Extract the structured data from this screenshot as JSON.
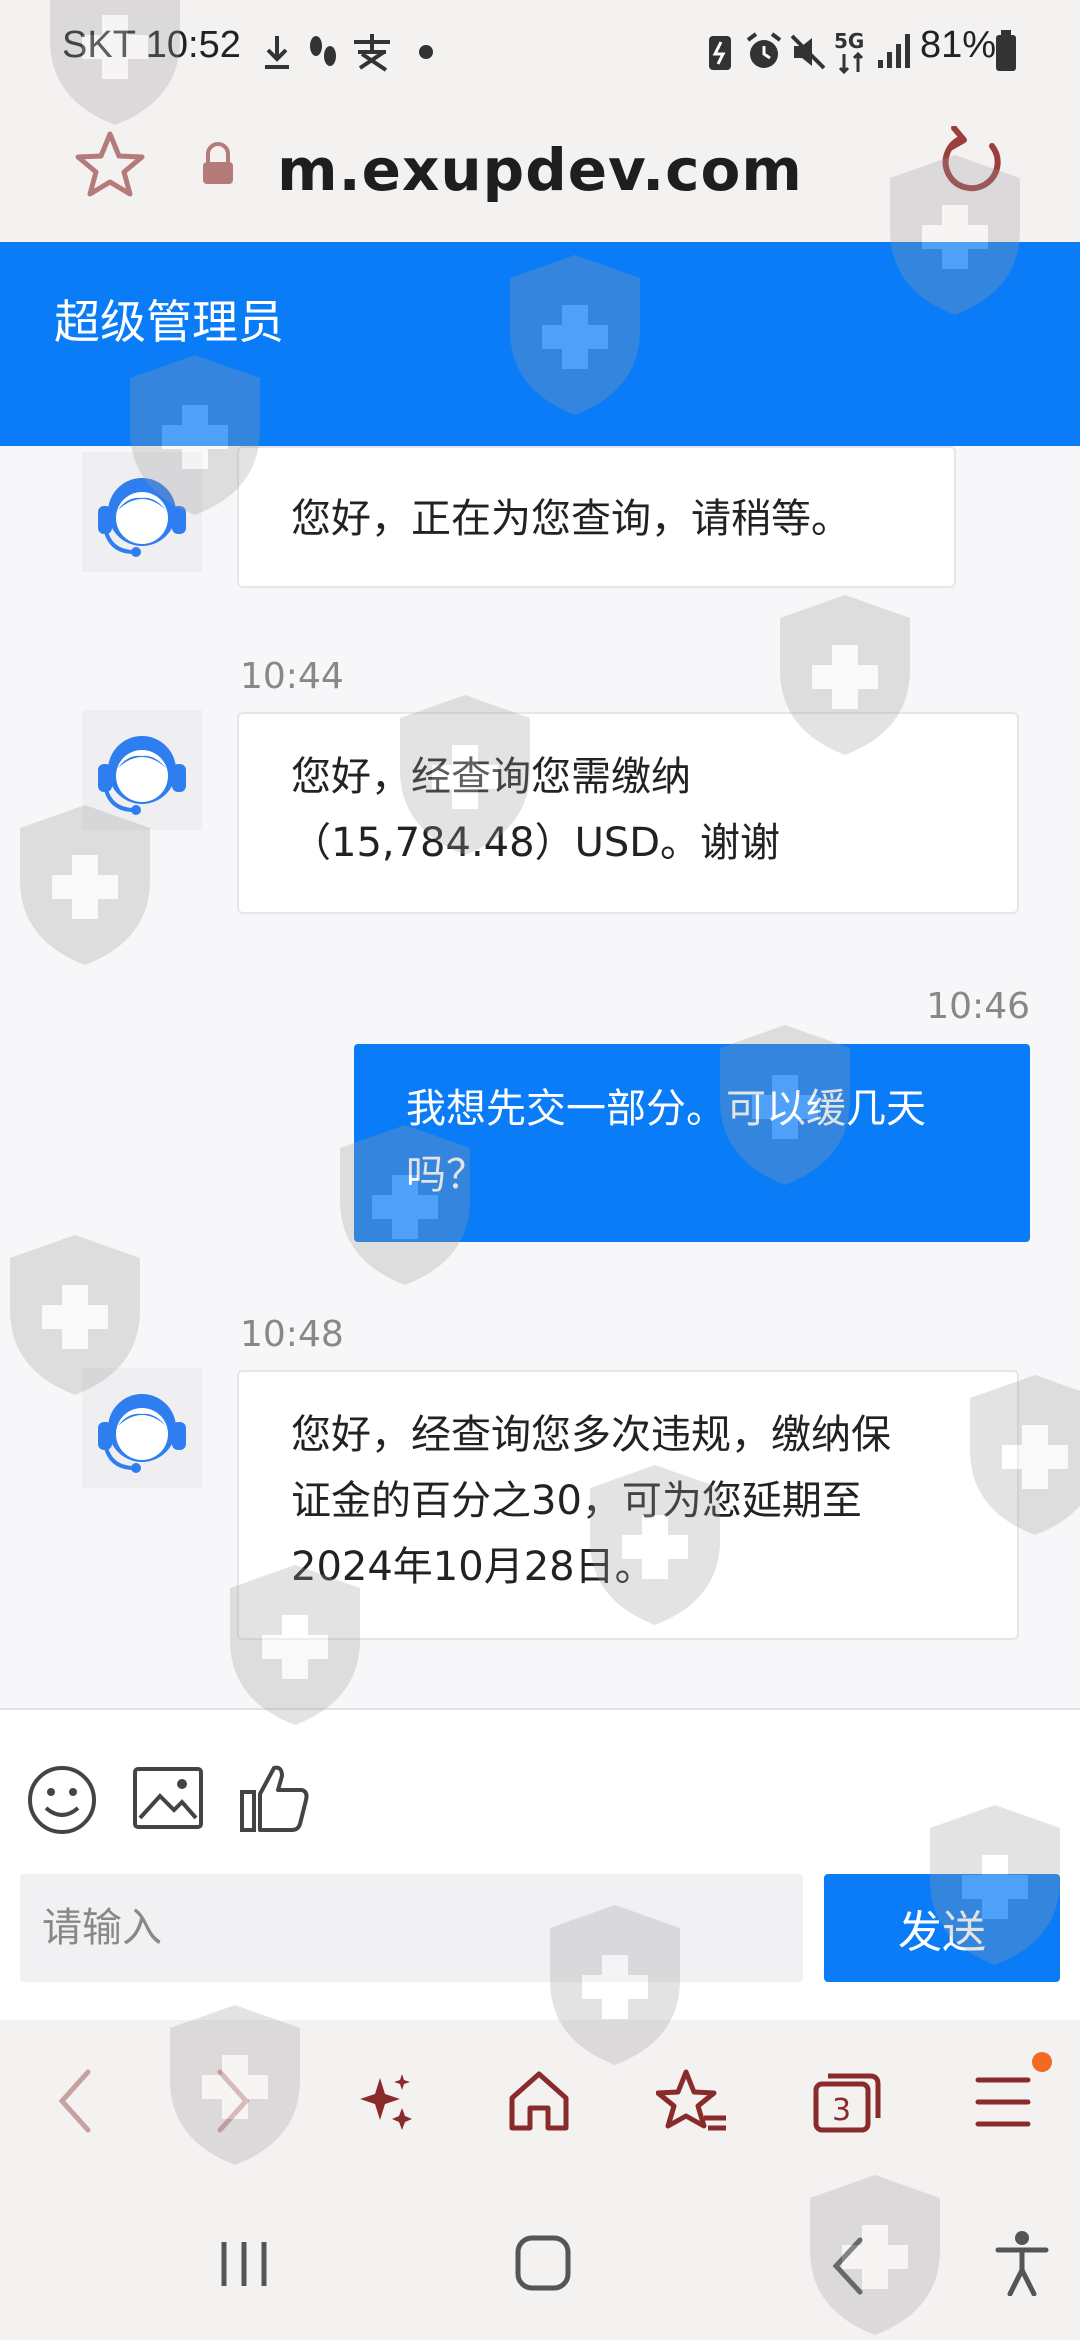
{
  "status_bar": {
    "carrier_time": "SKT 10:52",
    "battery": "81%"
  },
  "browser": {
    "url": "m.exupdev.com",
    "tab_count": "3"
  },
  "header": {
    "title": "超级管理员"
  },
  "messages": [
    {
      "from": "agent",
      "time": "",
      "lines": [
        "您好，正在为您查询，请稍等。"
      ]
    },
    {
      "from": "agent",
      "time": "10:44",
      "lines": [
        "您好，经查询您需缴纳",
        "（15,784.48）USD。谢谢"
      ]
    },
    {
      "from": "user",
      "time": "10:46",
      "lines": [
        "我想先交一部分。可以缓几天",
        "吗？"
      ]
    },
    {
      "from": "agent",
      "time": "10:48",
      "lines": [
        "您好，经查询您多次违规，缴纳保",
        "证金的百分之30，可为您延期至",
        "2024年10月28日。"
      ]
    }
  ],
  "composer": {
    "placeholder": "请输入",
    "send_label": "发送"
  },
  "colors": {
    "accent": "#0a7cf8",
    "browser_icon": "#8a2b2b"
  }
}
